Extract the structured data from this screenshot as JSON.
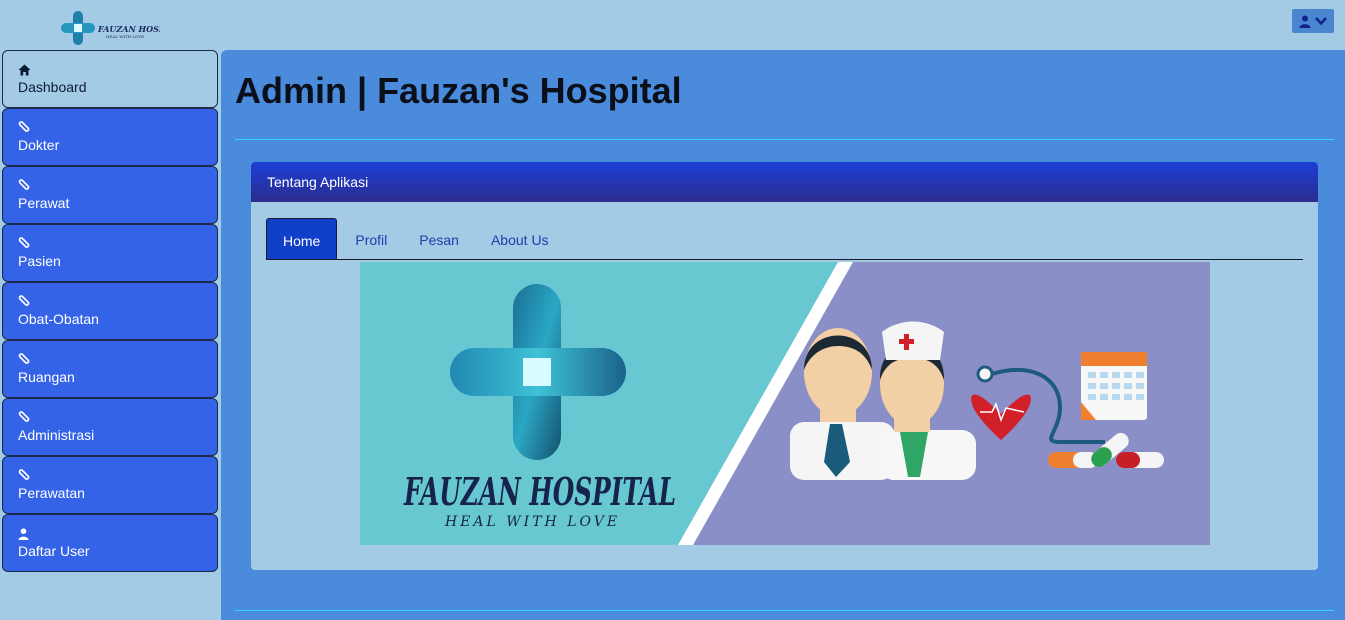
{
  "header": {
    "logo_text": "FAUZAN HOSPITAL",
    "logo_tagline": "HEAL WITH LOVE",
    "user_icon": "user-icon",
    "dropdown_icon": "chevron-down-icon"
  },
  "sidebar": {
    "items": [
      {
        "label": "Dashboard",
        "icon": "home-icon"
      },
      {
        "label": "Dokter",
        "icon": "paperclip-icon"
      },
      {
        "label": "Perawat",
        "icon": "paperclip-icon"
      },
      {
        "label": "Pasien",
        "icon": "paperclip-icon"
      },
      {
        "label": "Obat-Obatan",
        "icon": "paperclip-icon"
      },
      {
        "label": "Ruangan",
        "icon": "paperclip-icon"
      },
      {
        "label": "Administrasi",
        "icon": "paperclip-icon"
      },
      {
        "label": "Perawatan",
        "icon": "paperclip-icon"
      },
      {
        "label": "Daftar User",
        "icon": "user-icon"
      }
    ]
  },
  "main": {
    "title": "Admin | Fauzan's Hospital",
    "panel_title": "Tentang Aplikasi",
    "tabs": [
      {
        "label": "Home"
      },
      {
        "label": "Profil"
      },
      {
        "label": "Pesan"
      },
      {
        "label": "About Us"
      }
    ],
    "banner": {
      "title": "FAUZAN HOSPITAL",
      "tagline": "HEAL WITH LOVE"
    }
  },
  "colors": {
    "background": "#a3cbe6",
    "sidebar_item": "#3563e8",
    "main_panel": "#4a8bdb",
    "panel_header": "#1c3fd8",
    "active_tab": "#1040c8",
    "divider": "#37d3ff"
  }
}
